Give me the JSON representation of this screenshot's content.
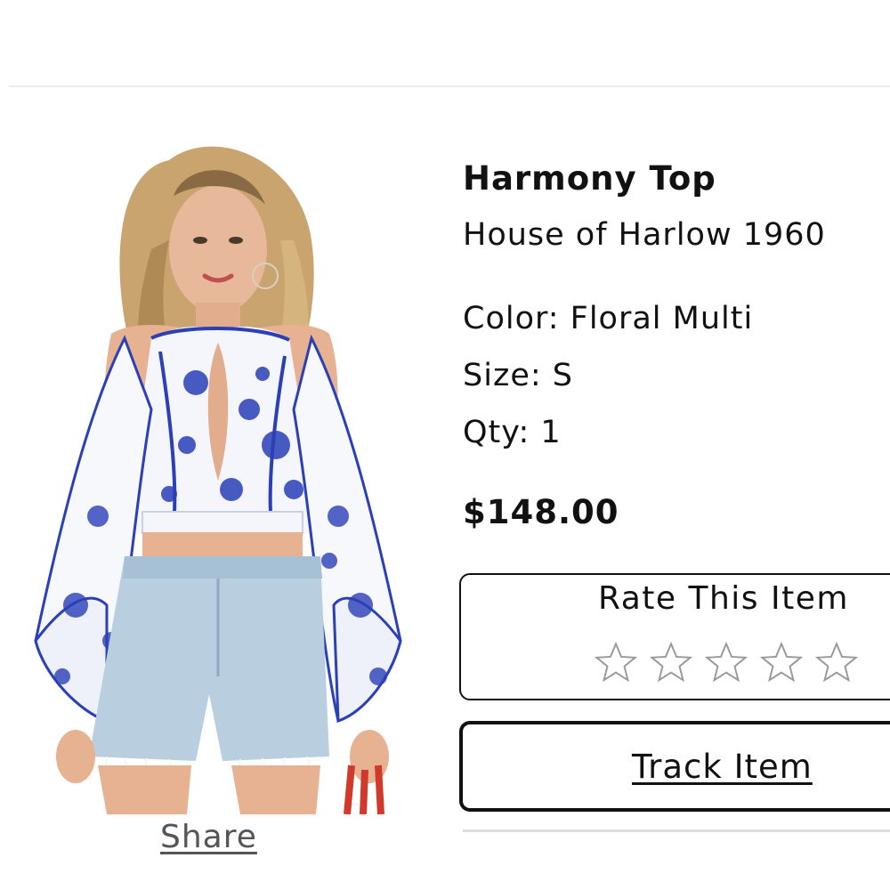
{
  "product": {
    "name": "Harmony Top",
    "brand": "House of Harlow 1960",
    "color_text": "Color: Floral Multi",
    "size_text": "Size: S",
    "qty_text": "Qty: 1",
    "price": "$148.00",
    "image_icon": "product-photo-floral-top"
  },
  "actions": {
    "share_label": "Share",
    "rate_title": "Rate This Item",
    "rating": 0,
    "rating_max": 5,
    "track_label": "Track Item"
  },
  "colors": {
    "text": "#111111",
    "muted": "#555555",
    "star_outline": "#999999",
    "floral_blue": "#2a3fb8"
  }
}
